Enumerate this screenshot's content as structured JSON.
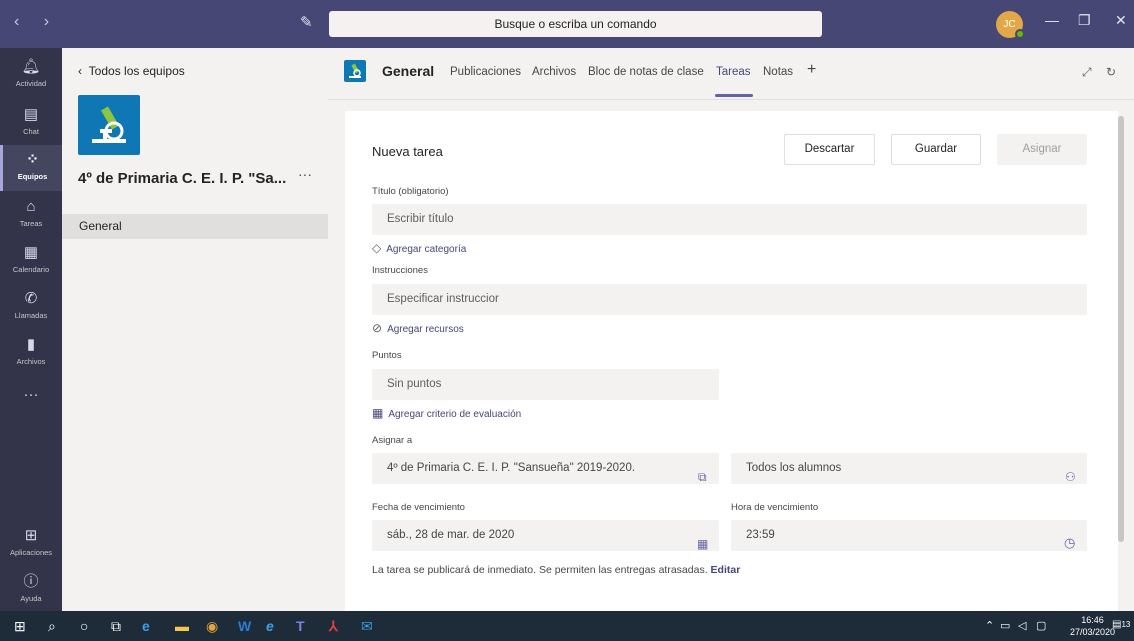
{
  "titlebar": {
    "search_placeholder": "Busque o escriba un comando",
    "avatar_initials": "JC"
  },
  "rail": {
    "items": [
      {
        "label": "Actividad",
        "icon": "bell-icon"
      },
      {
        "label": "Chat",
        "icon": "chat-icon"
      },
      {
        "label": "Equipos",
        "icon": "teams-icon"
      },
      {
        "label": "Tareas",
        "icon": "assignments-icon"
      },
      {
        "label": "Calendario",
        "icon": "calendar-icon"
      },
      {
        "label": "Llamadas",
        "icon": "phone-icon"
      },
      {
        "label": "Archivos",
        "icon": "files-icon"
      },
      {
        "label": "Aplicaciones",
        "icon": "apps-icon"
      },
      {
        "label": "Ayuda",
        "icon": "help-icon"
      }
    ],
    "more": "···"
  },
  "teams_panel": {
    "back_label": "Todos los equipos",
    "team_name": "4º de Primaria C. E. I. P. \"Sa...",
    "more": "···",
    "channels": [
      "General"
    ]
  },
  "channel": {
    "title": "General",
    "tabs": [
      "Publicaciones",
      "Archivos",
      "Bloc de notas de clase",
      "Tareas",
      "Notas"
    ],
    "active_tab": "Tareas",
    "add_tab": "+"
  },
  "form": {
    "heading": "Nueva tarea",
    "discard": "Descartar",
    "save": "Guardar",
    "assign": "Asignar",
    "title_label": "Título (obligatorio)",
    "title_placeholder": "Escribir título",
    "add_category": "Agregar categoría",
    "instructions_label": "Instrucciones",
    "instructions_placeholder": "Especificar instruccior",
    "add_resources": "Agregar recursos",
    "points_label": "Puntos",
    "points_value": "Sin puntos",
    "add_rubric": "Agregar criterio de evaluación",
    "assign_to_label": "Asignar a",
    "assign_class": "4º de Primaria C. E. I. P. \"Sansueña\" 2019-2020.",
    "assign_students": "Todos los alumnos",
    "due_date_label": "Fecha de vencimiento",
    "due_date": "sáb., 28 de mar. de 2020",
    "due_time_label": "Hora de vencimiento",
    "due_time": "23:59",
    "note": "La tarea se publicará de inmediato. Se permiten las entregas atrasadas.",
    "edit": "Editar"
  },
  "taskbar": {
    "time": "16:46",
    "date": "27/03/2020",
    "notifications": "13"
  },
  "colors": {
    "titlebar": "#464775",
    "rail": "#33344a",
    "accent": "#6264a7"
  }
}
